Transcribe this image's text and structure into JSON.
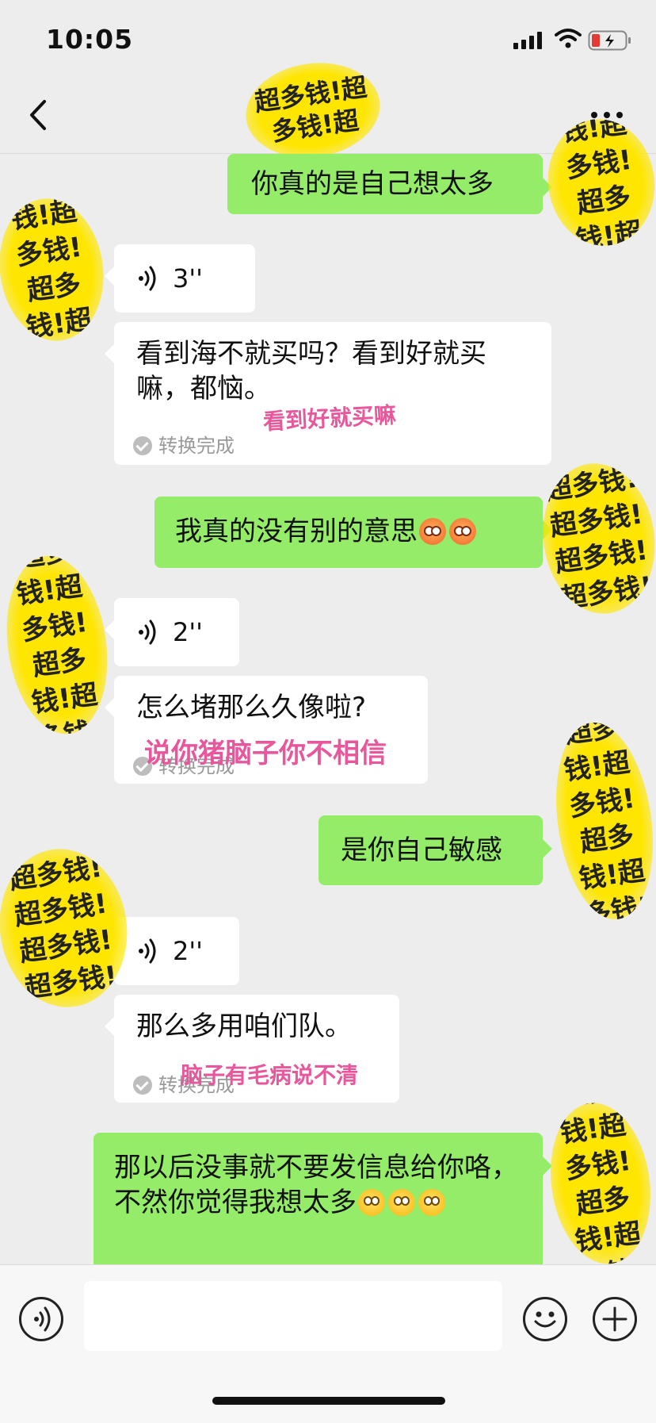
{
  "status_bar": {
    "time": "10:05"
  },
  "header": {
    "contact_stamp": "超多钱!超多钱!超"
  },
  "stamp_text": "超多钱!超多钱!超多钱!超多钱!",
  "messages": [
    {
      "side": "right",
      "text": "你真的是自己想太多"
    },
    {
      "side": "left",
      "type": "voice",
      "duration": "3''"
    },
    {
      "side": "left",
      "type": "transcript",
      "text": "看到海不就买吗？看到好就买嘛，都恼。",
      "status": "转换完成",
      "annotation": "看到好就买嘛"
    },
    {
      "side": "right",
      "text": "我真的没有别的意思"
    },
    {
      "side": "left",
      "type": "voice",
      "duration": "2''"
    },
    {
      "side": "left",
      "type": "transcript",
      "text": "怎么堵那么久像啦?",
      "status": "转换完成",
      "annotation": "说你猪脑子你不相信"
    },
    {
      "side": "right",
      "text": "是你自己敏感"
    },
    {
      "side": "left",
      "type": "voice",
      "duration": "2''"
    },
    {
      "side": "left",
      "type": "transcript",
      "text": "那么多用咱们队。",
      "status": "转换完成",
      "annotation": "脑子有毛病说不清"
    },
    {
      "side": "right",
      "text": "那以后没事就不要发信息给你咯，不然你觉得我想太多"
    }
  ],
  "input": {
    "value": "",
    "placeholder": ""
  },
  "icons": {
    "back": "back-chevron-icon",
    "more": "more-dots-icon",
    "voice": "voice-wave-icon",
    "emoji": "smiley-icon",
    "plus": "plus-icon"
  },
  "colors": {
    "own_bubble": "#95ec69",
    "other_bubble": "#ffffff",
    "background": "#ededed",
    "annotation": "#e8579b",
    "stamp": "#ffe600"
  }
}
